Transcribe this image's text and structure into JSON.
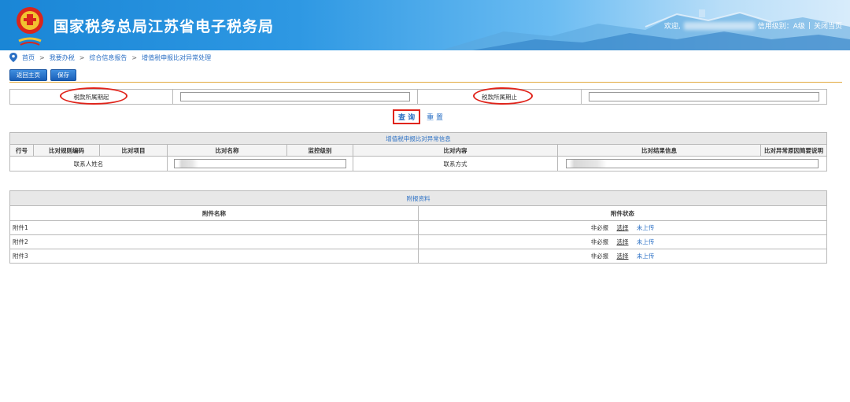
{
  "header": {
    "title": "国家税务总局江苏省电子税务局",
    "welcome": "欢迎,",
    "credit": "信用级别：A级",
    "separator": "|",
    "close": "关闭当页",
    "colors": {
      "bg_start": "#1a86d6",
      "bg_end": "#d8ecfb"
    }
  },
  "breadcrumb": {
    "items": [
      "首页",
      "我要办税",
      "综合信息报告",
      "增值税申报比对异常处理"
    ],
    "separator": ">"
  },
  "toolbar": {
    "back_label": "返回主页",
    "save_label": "保存"
  },
  "period": {
    "start_label": "税款所属期起",
    "end_label": "税款所属期止",
    "start_value": "",
    "end_value": ""
  },
  "query": {
    "query_label": "查 询",
    "reset_label": "重 置"
  },
  "compare": {
    "title": "增值税申报比对异常信息",
    "columns": [
      "行号",
      "比对规则编码",
      "比对项目",
      "比对名称",
      "监控级别",
      "比对内容",
      "比对结果信息",
      "比对异常原因简要说明"
    ],
    "contact_name_label": "联系人姓名",
    "contact_method_label": "联系方式"
  },
  "attachments": {
    "title": "附报资料",
    "columns": [
      "附件名称",
      "附件状态"
    ],
    "rows": [
      {
        "name": "附件1",
        "required": "非必报",
        "action": "选择",
        "status": "未上传"
      },
      {
        "name": "附件2",
        "required": "非必报",
        "action": "选择",
        "status": "未上传"
      },
      {
        "name": "附件3",
        "required": "非必报",
        "action": "选择",
        "status": "未上传"
      }
    ]
  }
}
